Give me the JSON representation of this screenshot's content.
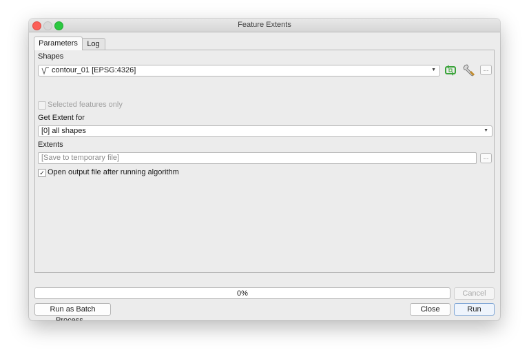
{
  "window": {
    "title": "Feature Extents"
  },
  "tabs": [
    {
      "label": "Parameters",
      "active": true
    },
    {
      "label": "Log",
      "active": false
    }
  ],
  "params": {
    "shapes_label": "Shapes",
    "shapes_value": "contour_01 [EPSG:4326]",
    "selected_only_label": "Selected features only",
    "selected_only_checked": false,
    "get_extent_label": "Get Extent for",
    "get_extent_value": "[0] all shapes",
    "extents_label": "Extents",
    "extents_placeholder": "[Save to temporary file]",
    "open_output_label": "Open output file after running algorithm",
    "open_output_checked": true,
    "browse_glyph": "…"
  },
  "progress": {
    "value_percent": 0,
    "text": "0%"
  },
  "buttons": {
    "cancel": "Cancel",
    "batch": "Run as Batch Process...",
    "close": "Close",
    "run": "Run"
  },
  "icons": {
    "layer_type": "line-layer-icon",
    "iterate": "iterate-icon",
    "settings": "wrench-icon"
  },
  "colors": {
    "iterate_green": "#3aa33a",
    "close_red": "#fc5f57",
    "max_green": "#2bc840"
  }
}
